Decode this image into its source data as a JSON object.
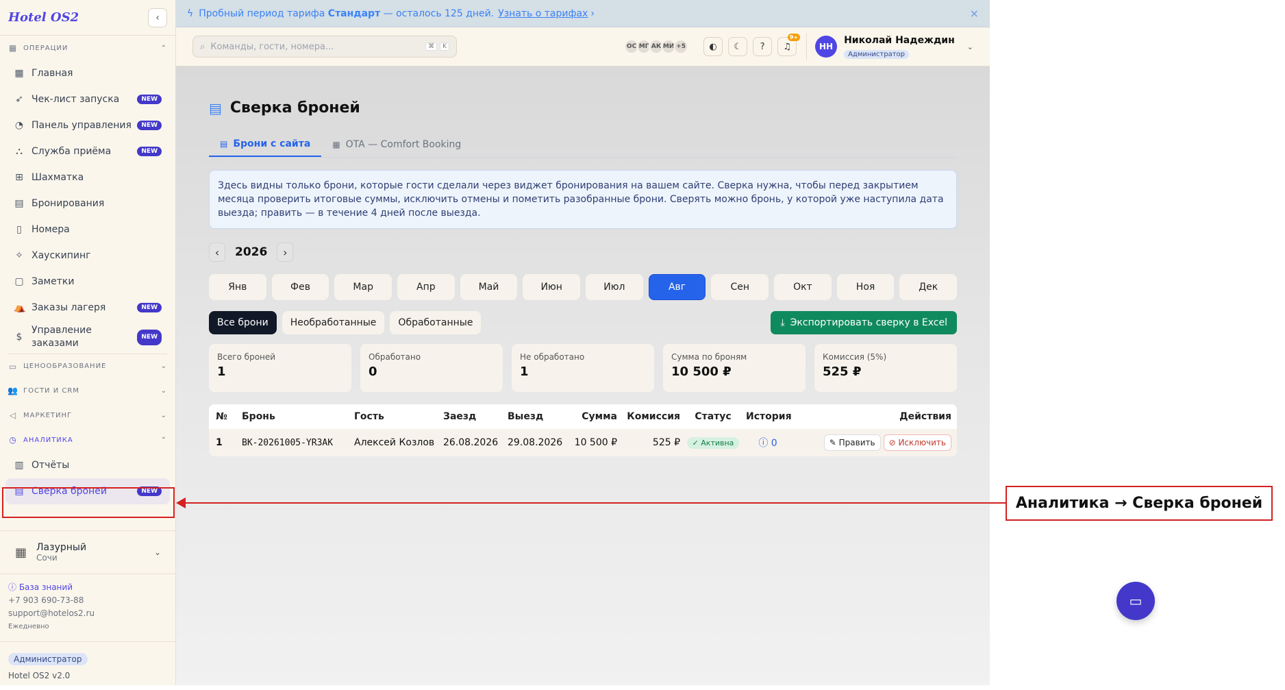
{
  "sidebar": {
    "logo": "Hotel OS2",
    "collapse_icon": "‹",
    "sections": {
      "operations": "Операции",
      "pricing": "Ценообразование",
      "guests": "Гости и CRM",
      "marketing": "Маркетинг",
      "analytics": "Аналитика"
    },
    "items": [
      {
        "label": "Главная",
        "icon": "grid-icon",
        "badge": ""
      },
      {
        "label": "Чек-лист запуска",
        "icon": "rocket-icon",
        "badge": "NEW"
      },
      {
        "label": "Панель управления",
        "icon": "gauge-icon",
        "badge": "NEW"
      },
      {
        "label": "Служба приёма",
        "icon": "bell-icon",
        "badge": "NEW"
      },
      {
        "label": "Шахматка",
        "icon": "table-icon",
        "badge": ""
      },
      {
        "label": "Бронирования",
        "icon": "clipboard-icon",
        "badge": ""
      },
      {
        "label": "Номера",
        "icon": "door-icon",
        "badge": ""
      },
      {
        "label": "Хаускипинг",
        "icon": "sparkle-icon",
        "badge": ""
      },
      {
        "label": "Заметки",
        "icon": "note-icon",
        "badge": ""
      },
      {
        "label": "Заказы лагеря",
        "icon": "tent-icon",
        "badge": "NEW"
      },
      {
        "label": "Управление заказами",
        "icon": "dollar-icon",
        "badge": "NEW"
      }
    ],
    "analytics_items": [
      {
        "label": "Отчёты",
        "icon": "chart-icon",
        "badge": ""
      },
      {
        "label": "Сверка броней",
        "icon": "document-icon",
        "badge": "NEW"
      }
    ],
    "hotel": {
      "name": "Лазурный",
      "city": "Сочи"
    },
    "support": {
      "kb": "База знаний",
      "phone": "+7 903 690-73-88",
      "email": "support@hotelos2.ru",
      "hours": "Ежедневно"
    },
    "role": "Администратор",
    "version": "Hotel OS2 v2.0"
  },
  "trial": {
    "prefix": "Пробный период тарифа",
    "plan": "Стандарт",
    "suffix": "— осталось 125 дней.",
    "link": "Узнать о тарифах",
    "close": "×"
  },
  "topbar": {
    "search_placeholder": "Команды, гости, номера...",
    "kbd1": "⌘",
    "kbd2": "K",
    "avatars": [
      "ОС",
      "МГ",
      "АК",
      "МИ",
      "+5"
    ],
    "notif_count": "9+",
    "user_initials": "НН",
    "user_name": "Николай Надеждин",
    "user_role": "Администратор"
  },
  "page": {
    "title": "Сверка броней",
    "tabs": [
      "Брони с сайта",
      "OTA — Comfort Booking"
    ],
    "info": "Здесь видны только брони, которые гости сделали через виджет бронирования на вашем сайте. Сверка нужна, чтобы перед закрытием месяца проверить итоговые суммы, исключить отмены и пометить разобранные брони. Сверять можно бронь, у которой уже наступила дата выезда; править — в течение 4 дней после выезда.",
    "year": "2026",
    "months": [
      "Янв",
      "Фев",
      "Мар",
      "Апр",
      "Май",
      "Июн",
      "Июл",
      "Авг",
      "Сен",
      "Окт",
      "Ноя",
      "Дек"
    ],
    "active_month": "Авг",
    "filters": [
      "Все брони",
      "Необработанные",
      "Обработанные"
    ],
    "export": "Экспортировать сверку в Excel",
    "stats": [
      {
        "label": "Всего броней",
        "value": "1"
      },
      {
        "label": "Обработано",
        "value": "0"
      },
      {
        "label": "Не обработано",
        "value": "1"
      },
      {
        "label": "Сумма по броням",
        "value": "10 500 ₽"
      },
      {
        "label": "Комиссия (5%)",
        "value": "525 ₽"
      }
    ],
    "table": {
      "headers": [
        "№",
        "Бронь",
        "Гость",
        "Заезд",
        "Выезд",
        "Сумма",
        "Комиссия",
        "Статус",
        "История",
        "Действия"
      ],
      "rows": [
        {
          "num": "1",
          "booking": "BK-20261005-YR3AK",
          "guest": "Алексей Козлов",
          "checkin": "26.08.2026",
          "checkout": "29.08.2026",
          "sum": "10 500 ₽",
          "commission": "525 ₽",
          "status": "Активна",
          "history": "0",
          "edit": "Править",
          "exclude": "Исключить"
        }
      ]
    }
  },
  "annotation": "Аналитика → Сверка броней",
  "colors": {
    "accent": "#4f46e5",
    "primary": "#2563eb",
    "export": "#0f8a5f",
    "highlight": "#d42020"
  }
}
